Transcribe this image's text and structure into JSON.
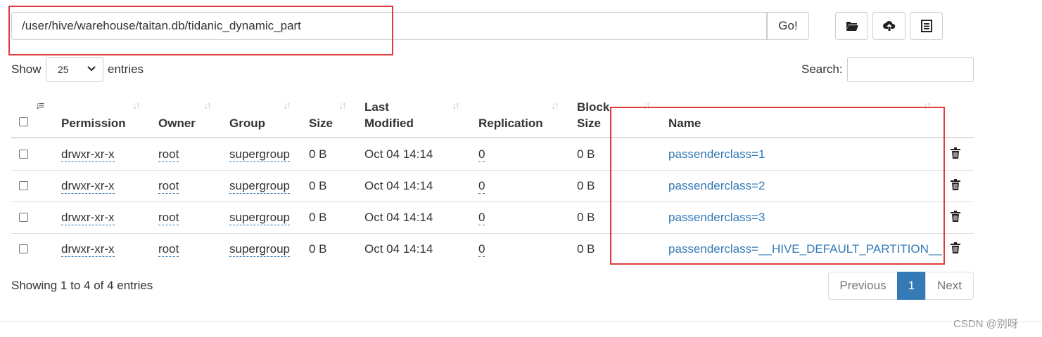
{
  "path_bar": {
    "path": "/user/hive/warehouse/taitan.db/tidanic_dynamic_part",
    "go_label": "Go!"
  },
  "toolbar": {
    "icons": [
      "folder-open-icon",
      "cloud-upload-icon",
      "list-alt-icon"
    ]
  },
  "controls": {
    "show_label": "Show",
    "page_length": "25",
    "entries_label": "entries",
    "search_label": "Search:",
    "search_value": ""
  },
  "table": {
    "columns": [
      "Permission",
      "Owner",
      "Group",
      "Size",
      "Last",
      "Modified",
      "Replication",
      "Block",
      "Size",
      "Name"
    ],
    "rows": [
      {
        "permission": "drwxr-xr-x",
        "owner": "root",
        "group": "supergroup",
        "size": "0 B",
        "last_modified": "Oct 04 14:14",
        "replication": "0",
        "block_size": "0 B",
        "name": "passenderclass=1"
      },
      {
        "permission": "drwxr-xr-x",
        "owner": "root",
        "group": "supergroup",
        "size": "0 B",
        "last_modified": "Oct 04 14:14",
        "replication": "0",
        "block_size": "0 B",
        "name": "passenderclass=2"
      },
      {
        "permission": "drwxr-xr-x",
        "owner": "root",
        "group": "supergroup",
        "size": "0 B",
        "last_modified": "Oct 04 14:14",
        "replication": "0",
        "block_size": "0 B",
        "name": "passenderclass=3"
      },
      {
        "permission": "drwxr-xr-x",
        "owner": "root",
        "group": "supergroup",
        "size": "0 B",
        "last_modified": "Oct 04 14:14",
        "replication": "0",
        "block_size": "0 B",
        "name": "passenderclass=__HIVE_DEFAULT_PARTITION__"
      }
    ]
  },
  "footer": {
    "info": "Showing 1 to 4 of 4 entries",
    "previous_label": "Previous",
    "page_label": "1",
    "next_label": "Next"
  },
  "watermark": "CSDN @别呀",
  "colors": {
    "link": "#337ab7",
    "annotation": "#e03c3c",
    "active_page": "#337ab7"
  }
}
